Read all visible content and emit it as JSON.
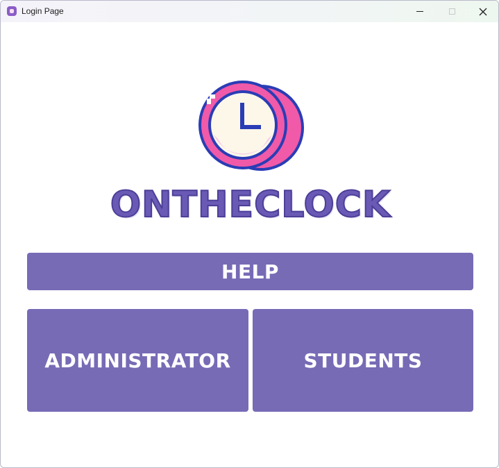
{
  "window": {
    "title": "Login Page"
  },
  "logo": {
    "icon": "pixel-clock-icon",
    "text": "ONTHECLOCK"
  },
  "actions": {
    "help_label": "HELP",
    "administrator_label": "ADMINISTRATOR",
    "students_label": "STUDENTS"
  },
  "colors": {
    "button_bg": "#776bb6",
    "brand_text": "#6a5ab5",
    "clock_ring": "#f05aa8",
    "clock_outline": "#2a3db5",
    "clock_face": "#fdf7ea"
  }
}
